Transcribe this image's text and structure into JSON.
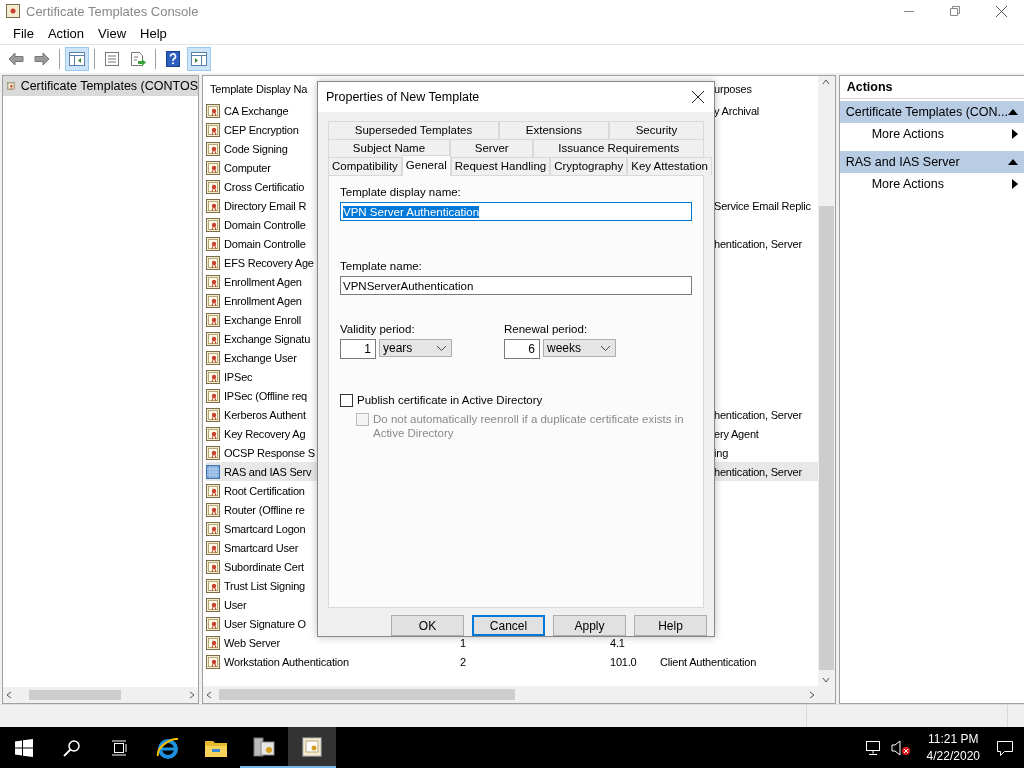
{
  "window": {
    "title": "Certificate Templates Console"
  },
  "menu": [
    "File",
    "Action",
    "View",
    "Help"
  ],
  "toolbar": [
    {
      "kind": "back",
      "on": false
    },
    {
      "kind": "forward",
      "on": false
    },
    {
      "kind": "separator"
    },
    {
      "kind": "tree-pane",
      "on": true
    },
    {
      "kind": "separator"
    },
    {
      "kind": "properties",
      "on": false
    },
    {
      "kind": "export",
      "on": false
    },
    {
      "kind": "separator"
    },
    {
      "kind": "help",
      "on": false
    },
    {
      "kind": "action-pane",
      "on": true
    }
  ],
  "tree": {
    "items": [
      {
        "label": "Certificate Templates (CONTOS",
        "selected": true
      }
    ]
  },
  "list": {
    "header": {
      "name": "Template Display Na",
      "purposes": "urposes"
    },
    "rows": [
      {
        "name": "CA Exchange",
        "kind": "partly-hidden",
        "selected": false,
        "purposes": "y Archival"
      },
      {
        "name": "CEP Encryption",
        "kind": "partly-hidden",
        "selected": false
      },
      {
        "name": "Code Signing",
        "kind": "partly-hidden",
        "selected": false
      },
      {
        "name": "Computer",
        "kind": "partly-hidden",
        "selected": false
      },
      {
        "name": "Cross Certificatio",
        "kind": "partly-hidden",
        "selected": false
      },
      {
        "name": "Directory Email R",
        "kind": "partly-hidden",
        "selected": false,
        "purposes": "Service Email Replic"
      },
      {
        "name": "Domain Controlle",
        "kind": "partly-hidden",
        "selected": false
      },
      {
        "name": "Domain Controlle",
        "kind": "partly-hidden",
        "selected": false,
        "purposes": "hentication, Server"
      },
      {
        "name": "EFS Recovery Age",
        "kind": "partly-hidden",
        "selected": false
      },
      {
        "name": "Enrollment Agen",
        "kind": "partly-hidden",
        "selected": false
      },
      {
        "name": "Enrollment Agen",
        "kind": "partly-hidden",
        "selected": false
      },
      {
        "name": "Exchange Enroll",
        "kind": "partly-hidden",
        "selected": false
      },
      {
        "name": "Exchange Signatu",
        "kind": "partly-hidden",
        "selected": false
      },
      {
        "name": "Exchange User",
        "kind": "partly-hidden",
        "selected": false
      },
      {
        "name": "IPSec",
        "kind": "partly-hidden",
        "selected": false
      },
      {
        "name": "IPSec (Offline req",
        "kind": "partly-hidden",
        "selected": false
      },
      {
        "name": "Kerberos Authent",
        "kind": "partly-hidden",
        "selected": false,
        "purposes": "hentication, Server"
      },
      {
        "name": "Key Recovery Ag",
        "kind": "partly-hidden",
        "selected": false,
        "purposes": "ery Agent"
      },
      {
        "name": "OCSP Response S",
        "kind": "partly-hidden",
        "selected": false,
        "purposes": "ing"
      },
      {
        "name": "RAS and IAS Serv",
        "kind": "partly-hidden",
        "selected": true,
        "purposes": "hentication, Server"
      },
      {
        "name": "Root Certification",
        "kind": "partly-hidden",
        "selected": false
      },
      {
        "name": "Router (Offline re",
        "kind": "partly-hidden",
        "selected": false
      },
      {
        "name": "Smartcard Logon",
        "kind": "partly-hidden",
        "selected": false
      },
      {
        "name": "Smartcard User",
        "kind": "partly-hidden",
        "selected": false
      },
      {
        "name": "Subordinate Cert",
        "kind": "partly-hidden",
        "selected": false
      },
      {
        "name": "Trust List Signing",
        "kind": "partly-hidden",
        "selected": false
      },
      {
        "name": "User",
        "kind": "partly-hidden",
        "selected": false
      },
      {
        "name": "User Signature O",
        "kind": "partly-hidden",
        "selected": false
      },
      {
        "name": "Web Server",
        "kind": "clear",
        "selected": false,
        "column_2": "1",
        "column_3": "4.1"
      },
      {
        "name": "Workstation Authentication",
        "kind": "clear",
        "selected": false,
        "column_2": "2",
        "column_3": "101.0",
        "purposes": "Client Authentication"
      }
    ]
  },
  "actions": {
    "title": "Actions",
    "sections": [
      {
        "title": "Certificate Templates (CON...",
        "expanded": true,
        "items": [
          "More Actions"
        ]
      },
      {
        "title": "RAS and IAS Server",
        "expanded": true,
        "items": [
          "More Actions"
        ]
      }
    ]
  },
  "dialog": {
    "title": "Properties of New Template",
    "tab_rows": [
      [
        {
          "label": "Superseded Templates",
          "selected": false
        },
        {
          "label": "Extensions",
          "selected": false
        },
        {
          "label": "Security",
          "selected": false
        }
      ],
      [
        {
          "label": "Subject Name",
          "selected": false
        },
        {
          "label": "Server",
          "selected": false
        },
        {
          "label": "Issuance Requirements",
          "selected": false
        }
      ],
      [
        {
          "label": "Compatibility",
          "selected": false
        },
        {
          "label": "General",
          "selected": true
        },
        {
          "label": "Request Handling",
          "selected": false
        },
        {
          "label": "Cryptography",
          "selected": false
        },
        {
          "label": "Key Attestation",
          "selected": false
        }
      ]
    ],
    "display_name": {
      "label": "Template display name:",
      "value": "VPN Server Authentication",
      "selected": true
    },
    "template_name": {
      "label": "Template name:",
      "value": "VPNServerAuthentication",
      "selected": false
    },
    "validity": {
      "label": "Validity period:",
      "value": "1",
      "unit": "years"
    },
    "renewal": {
      "label": "Renewal period:",
      "value": "6",
      "unit": "weeks"
    },
    "checkboxes": [
      {
        "label": "Publish certificate in Active Directory",
        "checked": false,
        "disabled": false
      },
      {
        "label": "Do not automatically reenroll if a duplicate certificate exists in Active Directory",
        "checked": false,
        "disabled": true
      }
    ],
    "buttons": [
      {
        "label": "OK",
        "default": false
      },
      {
        "label": "Cancel",
        "default": true
      },
      {
        "label": "Apply",
        "default": false
      },
      {
        "label": "Help",
        "default": false
      }
    ]
  },
  "taskbar": {
    "items": [
      {
        "kind": "start",
        "selected": false,
        "running": false
      },
      {
        "kind": "search",
        "selected": false,
        "running": false
      },
      {
        "kind": "task-view",
        "selected": false,
        "running": false
      },
      {
        "kind": "browser",
        "selected": false,
        "running": false
      },
      {
        "kind": "folder",
        "selected": false,
        "running": false
      },
      {
        "kind": "server-manager",
        "selected": false,
        "running": true
      },
      {
        "kind": "certificate-console",
        "selected": true,
        "running": true
      }
    ],
    "time": "11:21 PM",
    "date": "4/22/2020"
  }
}
